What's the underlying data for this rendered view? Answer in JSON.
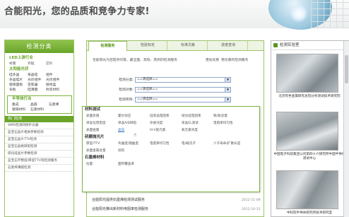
{
  "banner": {
    "slogan": "合能阳光，您的品质和竞争力专家!"
  },
  "left": {
    "title": "检测分类",
    "led_title": "LED上游行业",
    "led_items": [
      "衬底",
      "外延",
      "芯片"
    ],
    "solar_title": "太阳能光伏",
    "solar_rows": [
      [
        "硅多晶",
        "单晶硅",
        "组件"
      ],
      [
        "多晶硅片",
        "光伏组件",
        "光伏组件"
      ],
      [
        "玻璃面板",
        "逆变器",
        "接线盒"
      ],
      [
        "背板",
        "硅薄膜",
        "封装材料"
      ]
    ],
    "semi_title": "半导体行业",
    "semi_rows": [
      [
        "集成",
        "晶圆",
        "石墨烯"
      ],
      [
        "玻璃材料",
        "石墨材料",
        ""
      ]
    ],
    "hot_title": "热门检测",
    "hot_items": [
      "SIMS检测四探针仪器",
      "蓝宝石晶片相关参数检测",
      "蓝宝石晶片TTV检测",
      "蓝宝石晶格缺陷检测",
      "碳化硅晶片参数检测",
      "蓝宝石平整度/厚度TTV等检测服务",
      "石墨烯薄膜检测"
    ]
  },
  "tabs": [
    "检测服务",
    "检验标定",
    "标准文献",
    "进度查询"
  ],
  "query": {
    "intro": "合能阳光为您提供可靠、最全面、高效、周到的检测服务",
    "more1": "更加优质",
    "more2": "更优质的检测服务",
    "rows": [
      {
        "label": "检测分类:",
        "value": "==请选择=="
      },
      {
        "label": "检测对象:",
        "value": "==请选择=="
      },
      {
        "label": "检测项目:",
        "value": "==请选择=="
      }
    ]
  },
  "dropdown": {
    "sec1": "材料测试",
    "rows1": [
      [
        "表面形貌",
        "霍尔效应",
        "硅单晶电阻率",
        "碳化硅电阻率",
        "铁/氧含量"
      ],
      [
        "单晶位错密度",
        "单晶A/B缺陷",
        "杂质浓度",
        "单晶EL测试",
        "电阻率均匀性"
      ],
      [
        "表面金属",
        "晶向",
        "III-V族元素",
        "氧元素浓度",
        ""
      ]
    ],
    "sec2": "研磨抛光片",
    "rows2": [
      [
        "厚度/TTV",
        "弯曲度/翘曲度",
        "电阻率均匀性",
        "电/载流子",
        "少子寿命/扩散长度"
      ],
      [
        "表面金属含量",
        "划伤",
        "",
        "",
        ""
      ]
    ],
    "sec3": "石墨烯材料",
    "rows3": [
      [
        "拉曼",
        "面积覆盖率",
        "",
        "",
        ""
      ]
    ]
  },
  "news": [
    {
      "text": "合能阳光提供石墨烯检测测试服务",
      "date": "2012-11-09"
    },
    {
      "text": "合能阳光推出新材料电阻率检测服务",
      "date": "2012-10-31"
    }
  ],
  "right": {
    "title": "检测实验室",
    "captions": [
      "北京有色金属研究总院分析测试技术研究院",
      "中国电子科技集团公司第四十六研究所中国半导体测试中心",
      "中科院半导体研究所技术研究室"
    ]
  }
}
